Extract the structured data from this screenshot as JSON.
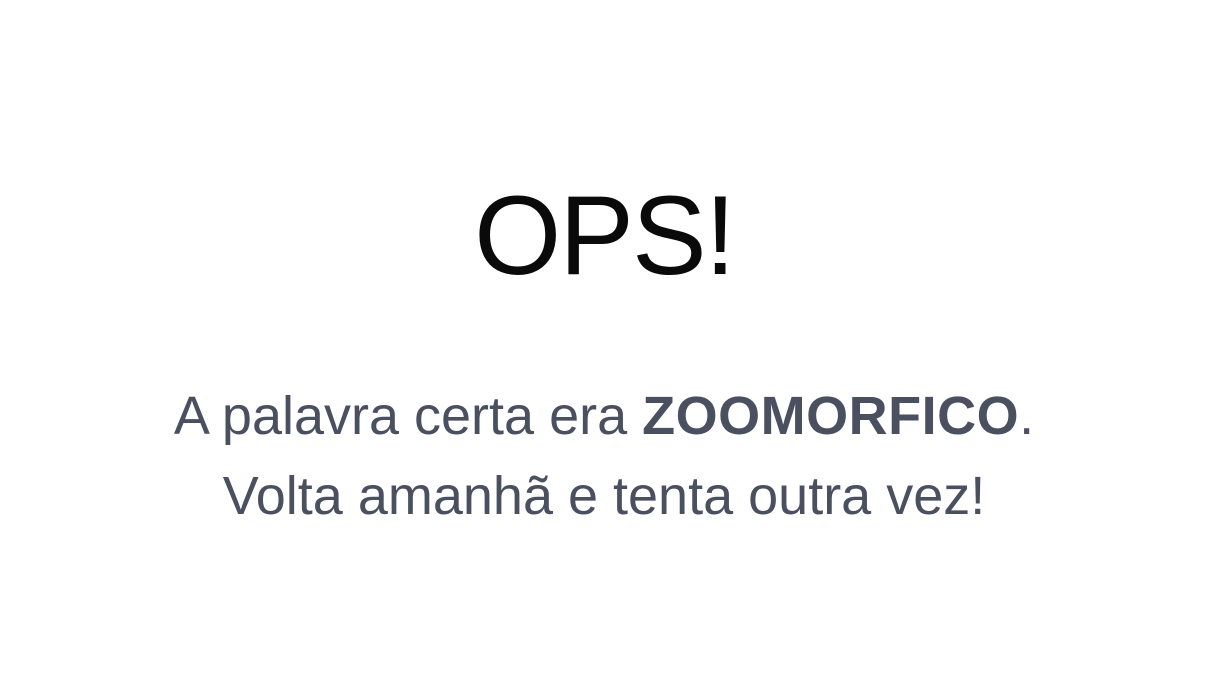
{
  "result": {
    "headline": "OPS!",
    "line1_prefix": "A palavra certa era ",
    "answer_word": "ZOOMORFICO",
    "line1_suffix": ".",
    "line2": "Volta amanhã e tenta outra vez!"
  },
  "colors": {
    "background": "#ffffff",
    "headline": "#0a0a0a",
    "message": "#4b5060"
  }
}
